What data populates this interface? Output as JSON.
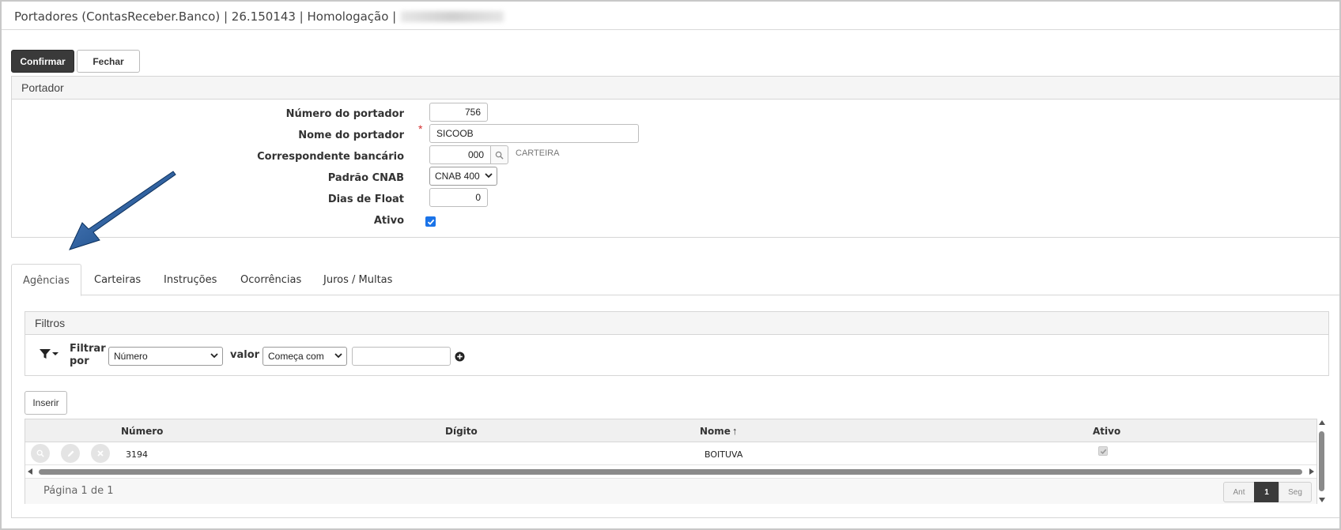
{
  "window": {
    "title": "Portadores (ContasReceber.Banco) | 26.150143 | Homologação |"
  },
  "toolbar": {
    "confirm_label": "Confirmar",
    "close_label": "Fechar"
  },
  "portador": {
    "section_title": "Portador",
    "fields": {
      "numero_label": "Número do portador",
      "numero_value": "756",
      "nome_label": "Nome do portador",
      "nome_value": "SICOOB",
      "required_mark": "*",
      "correspondente_label": "Correspondente bancário",
      "correspondente_value": "000",
      "correspondente_desc": "CARTEIRA",
      "cnab_label": "Padrão CNAB",
      "cnab_value": "CNAB 400",
      "float_label": "Dias de Float",
      "float_value": "0",
      "ativo_label": "Ativo",
      "ativo_checked": true
    }
  },
  "tabs": [
    {
      "label": "Agências",
      "active": true
    },
    {
      "label": "Carteiras",
      "active": false
    },
    {
      "label": "Instruções",
      "active": false
    },
    {
      "label": "Ocorrências",
      "active": false
    },
    {
      "label": "Juros / Multas",
      "active": false
    }
  ],
  "filters": {
    "title": "Filtros",
    "filter_by_label": "Filtrar por",
    "field_value": "Número",
    "value_label": "valor",
    "operator_value": "Começa com",
    "search_value": ""
  },
  "grid": {
    "insert_label": "Inserir",
    "columns": {
      "numero": "Número",
      "digito": "Dígito",
      "nome": "Nome",
      "ativo": "Ativo"
    },
    "sort_indicator": "↑",
    "rows": [
      {
        "numero": "3194",
        "digito": "",
        "nome": "BOITUVA",
        "ativo": true
      }
    ],
    "page_info": "Página 1 de 1",
    "pager": {
      "prev": "Ant",
      "current": "1",
      "next": "Seg"
    }
  },
  "colors": {
    "primary_button": "#3a3a3a",
    "arrow": "#0d3f78",
    "checkbox": "#1a73e8",
    "required": "#d32f2f"
  }
}
